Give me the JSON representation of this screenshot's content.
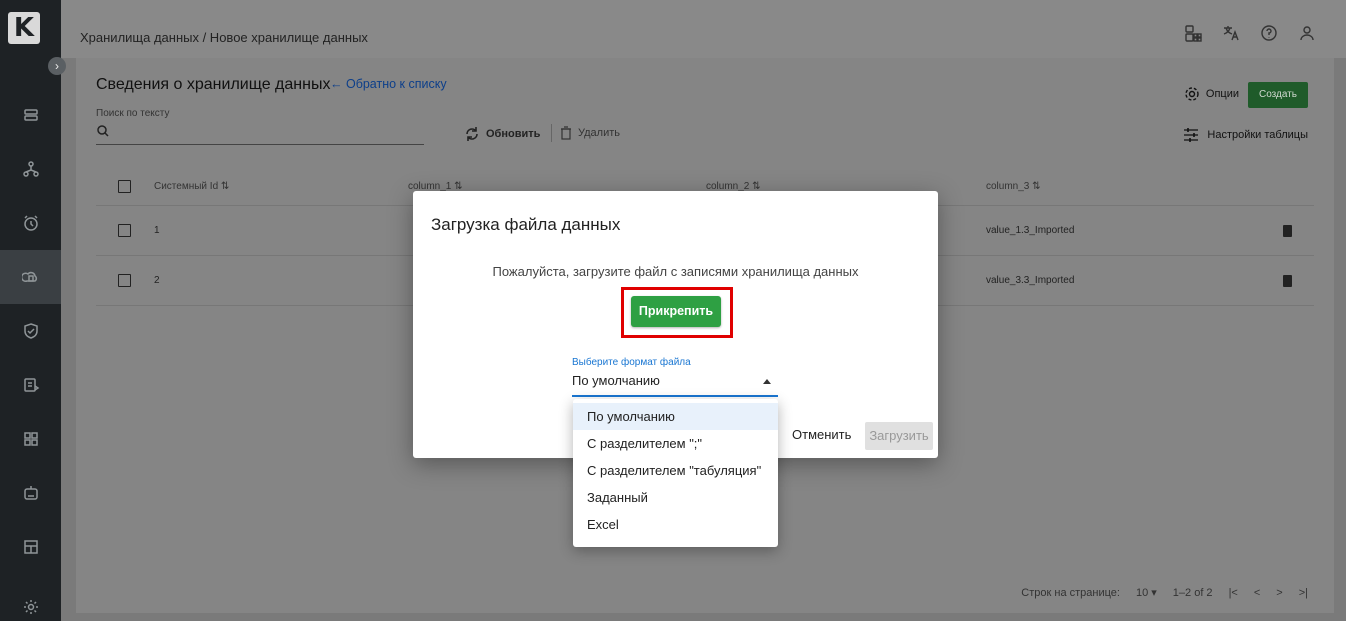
{
  "sidebar": {
    "logo": "K",
    "expand": "›",
    "items": [
      "storage-icon",
      "network-icon",
      "alarm-icon",
      "cloud-db-icon",
      "shield-icon",
      "document-icon",
      "apps-icon",
      "robot-icon",
      "dashboard-icon",
      "gear-icon"
    ]
  },
  "topbar": {
    "breadcrumb": "Хранилища данных / Новое хранилище данных"
  },
  "card": {
    "title": "Сведения о хранилище данных",
    "back": "← Обратно к списку",
    "search_label": "Поиск по тексту",
    "refresh": "Обновить",
    "delete": "Удалить",
    "options": "Опции",
    "create": "Создать",
    "table_settings": "Настройки таблицы"
  },
  "table": {
    "headers": [
      "Системный Id ⇅",
      "column_1 ⇅",
      "column_2 ⇅",
      "column_3 ⇅"
    ],
    "rows": [
      {
        "id": "1",
        "col3": "value_1.3_Imported"
      },
      {
        "id": "2",
        "col3": "value_3.3_Imported"
      }
    ]
  },
  "pager": {
    "rows_label": "Строк на странице:",
    "rows_value": "10 ▾",
    "range": "1–2 of 2",
    "first": "|<",
    "prev": "<",
    "next": ">",
    "last": ">|"
  },
  "modal": {
    "title": "Загрузка файла данных",
    "text": "Пожалуйста, загрузите файл с записями хранилища данных",
    "attach": "Прикрепить",
    "format_label": "Выберите формат файла",
    "format_value": "По умолчанию",
    "cancel": "Отменить",
    "upload": "Загрузить"
  },
  "dropdown": {
    "options": [
      "По умолчанию",
      "С разделителем \";\"",
      "С разделителем \"табуляция\"",
      "Заданный",
      "Excel"
    ],
    "selected_index": 0
  },
  "colors": {
    "primary_green": "#2ea043",
    "highlight_red": "#e00000",
    "accent_blue": "#1976d2",
    "sidebar_bg": "#1e2225"
  }
}
